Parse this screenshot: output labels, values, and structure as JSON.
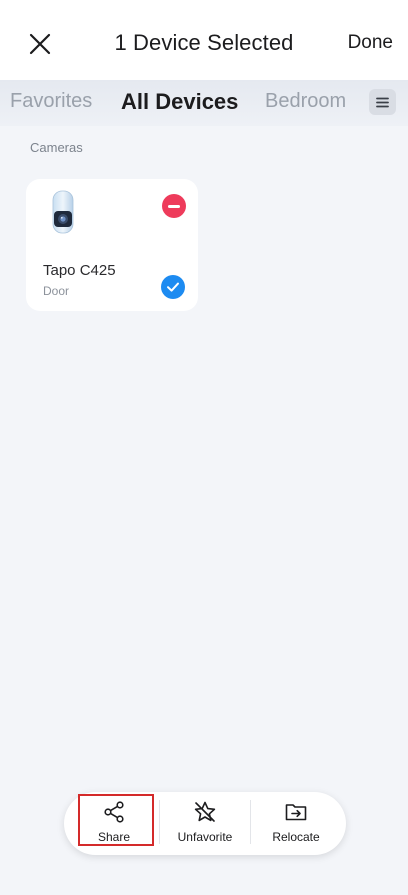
{
  "header": {
    "title": "1 Device Selected",
    "done_label": "Done",
    "close_icon": "close-icon"
  },
  "tabs": [
    {
      "label": "Favorites",
      "active": false
    },
    {
      "label": "All Devices",
      "active": true
    },
    {
      "label": "Bedroom",
      "active": false
    }
  ],
  "section": {
    "label": "Cameras"
  },
  "devices": [
    {
      "name": "Tapo C425",
      "room": "Door",
      "selected": true,
      "icon": "camera-icon"
    }
  ],
  "actions": [
    {
      "label": "Share",
      "icon": "share-icon"
    },
    {
      "label": "Unfavorite",
      "icon": "star-off-icon"
    },
    {
      "label": "Relocate",
      "icon": "folder-move-icon"
    }
  ],
  "colors": {
    "accent": "#1d8bf1",
    "remove": "#ee3b5b",
    "highlight": "#d42a2a",
    "background": "#f3f5f9"
  }
}
